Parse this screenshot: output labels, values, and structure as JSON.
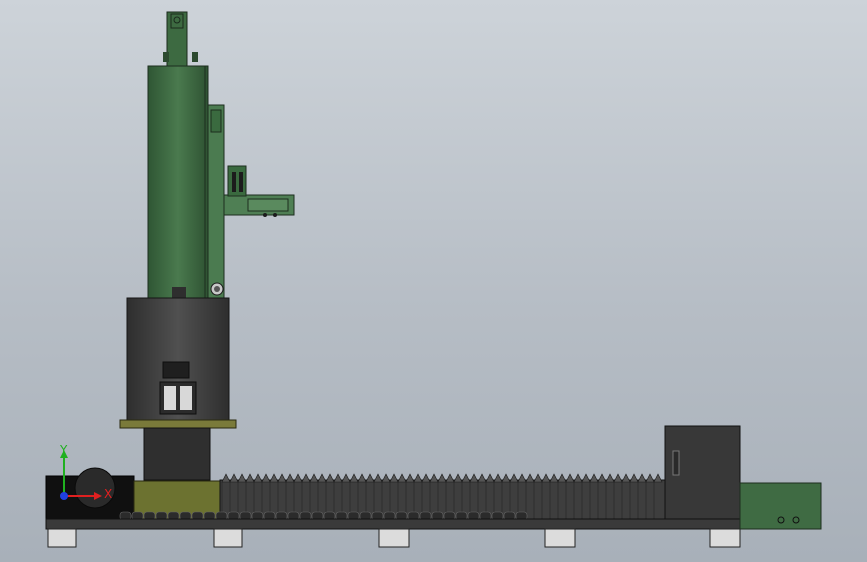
{
  "viewport": {
    "background_top": "#cdd3d9",
    "background_bottom": "#a8b0b9"
  },
  "model": {
    "column_color": "#3f6b43",
    "base_color": "#3f3f3f",
    "bellows_color": "#4a4a4a",
    "carriage_color": "#6e7431",
    "cabinet_color": "#3a3a3a",
    "motor_box_color": "#3f6b43"
  },
  "triad": {
    "x_label": "X",
    "y_label": "Y",
    "x_color": "#e02020",
    "y_color": "#20b020",
    "z_color": "#2040e0"
  }
}
